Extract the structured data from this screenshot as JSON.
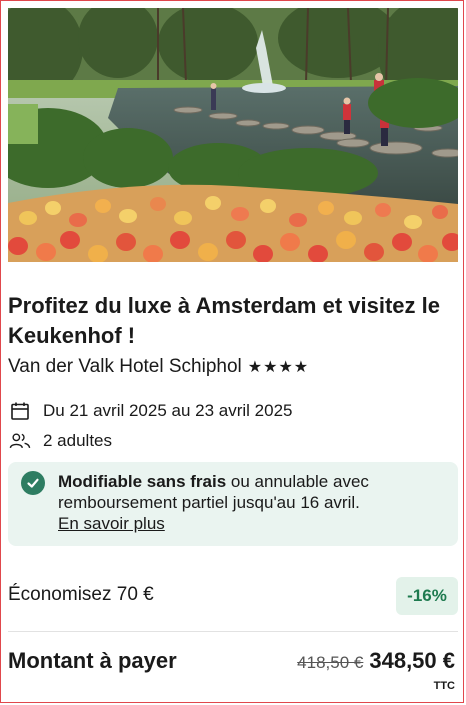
{
  "offer": {
    "title": "Profitez du luxe à Amsterdam et visitez le Keukenhof !",
    "hotel_name": "Van der Valk Hotel Schiphol",
    "stars": "★★★★",
    "dates": "Du 21 avril 2025 au 23 avril 2025",
    "guests": "2 adultes"
  },
  "notice": {
    "strong": "Modifiable sans frais",
    "rest": " ou annulable avec remboursement partiel jusqu'au 16 avril.",
    "link": "En savoir plus"
  },
  "savings": {
    "label": "Économisez 70 €",
    "badge": "-16%"
  },
  "total": {
    "label": "Montant à payer",
    "old_price": "418,50 €",
    "new_price": "348,50 €",
    "tax_note": "TTC"
  },
  "colors": {
    "border": "#e0474c",
    "accent_green": "#2e7d62",
    "notice_bg": "#eaf4f0"
  },
  "icons": [
    "calendar-icon",
    "people-icon",
    "check-circle-icon"
  ]
}
